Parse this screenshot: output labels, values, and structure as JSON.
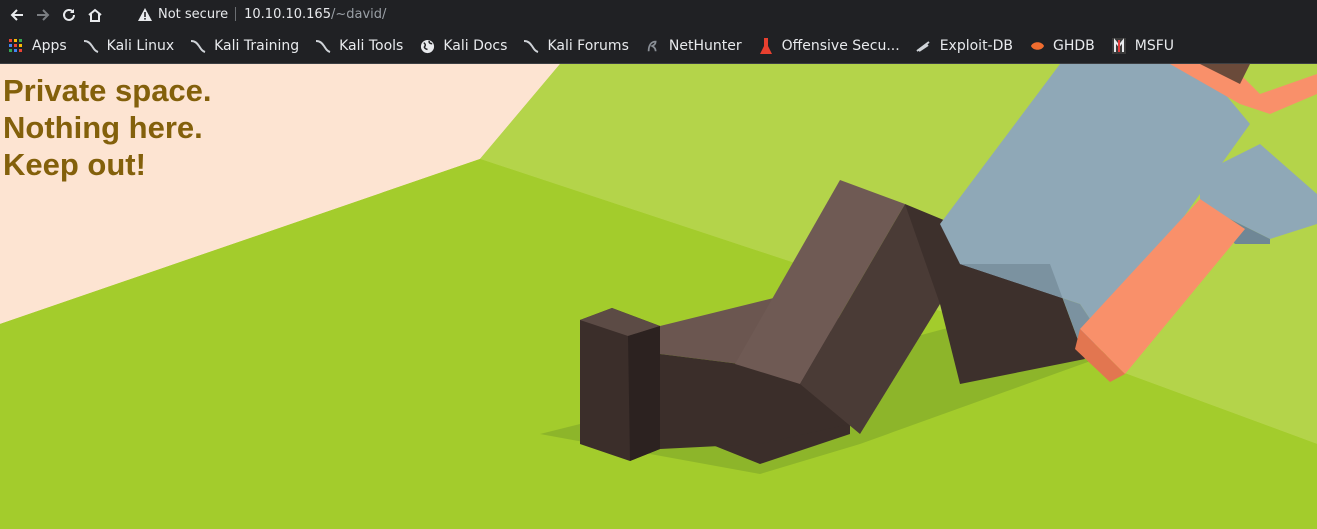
{
  "browser": {
    "security_label": "Not secure",
    "url_host": "10.10.10.165",
    "url_path": "/~david/",
    "icons": [
      "back-icon",
      "forward-icon",
      "reload-icon",
      "home-icon",
      "warning-icon"
    ]
  },
  "bookmarks": [
    {
      "label": "Apps",
      "icon": "apps-grid-icon"
    },
    {
      "label": "Kali Linux",
      "icon": "kali-dragon-icon"
    },
    {
      "label": "Kali Training",
      "icon": "kali-dragon-icon"
    },
    {
      "label": "Kali Tools",
      "icon": "kali-dragon-icon"
    },
    {
      "label": "Kali Docs",
      "icon": "globe-icon"
    },
    {
      "label": "Kali Forums",
      "icon": "kali-dragon-icon"
    },
    {
      "label": "NetHunter",
      "icon": "nethunter-icon"
    },
    {
      "label": "Offensive Secu...",
      "icon": "offsec-icon"
    },
    {
      "label": "Exploit-DB",
      "icon": "exploit-db-icon"
    },
    {
      "label": "GHDB",
      "icon": "ghdb-icon"
    },
    {
      "label": "MSFU",
      "icon": "msfu-icon"
    }
  ],
  "page": {
    "lines": [
      "Private space.",
      "Nothing here.",
      "Keep out!"
    ],
    "text_color": "#83600b",
    "background_colors": {
      "grass": "#a3cc2c",
      "sand": "#fde4d2",
      "figure_dark": "#4a3b36",
      "shirt": "#8fa8b7",
      "skin": "#f9906a"
    }
  }
}
